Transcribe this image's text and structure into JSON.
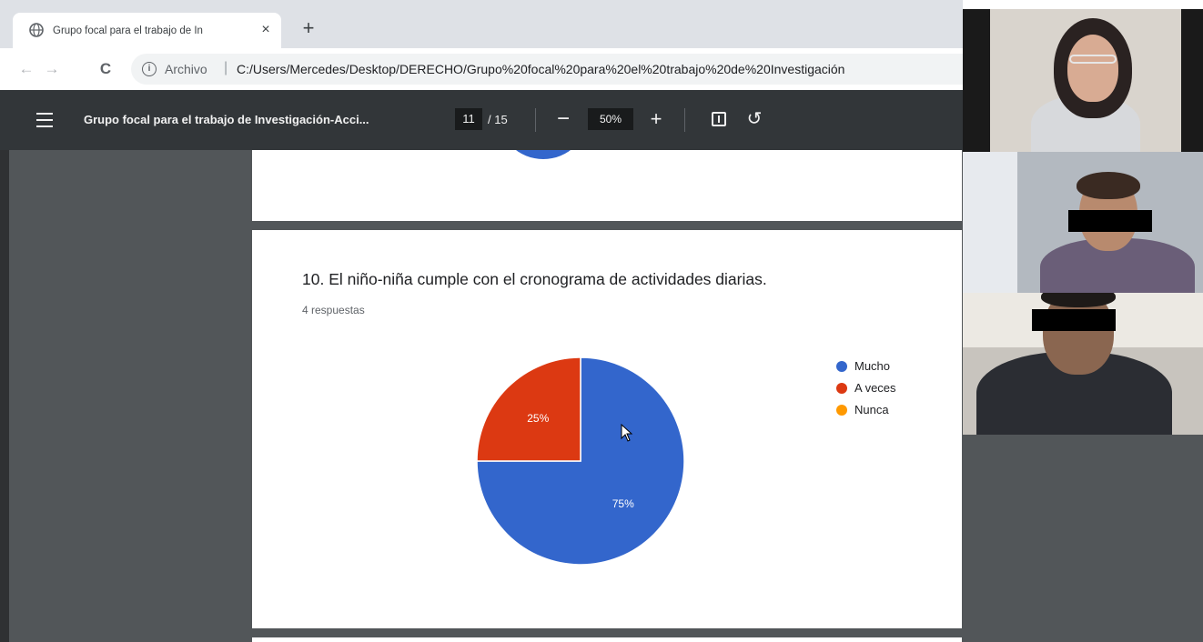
{
  "browser": {
    "tab": {
      "title": "Grupo focal para el trabajo de In",
      "close_label": "×"
    },
    "new_tab_label": "+",
    "address": {
      "security_label": "Archivo",
      "separator": "|",
      "url": "C:/Users/Mercedes/Desktop/DERECHO/Grupo%20focal%20para%20el%20trabajo%20de%20Investigación"
    },
    "nav": {
      "back": "←",
      "forward": "→",
      "reload": "C"
    }
  },
  "pdf_toolbar": {
    "title": "Grupo focal para el trabajo de Investigación-Acci...",
    "page_current": "11",
    "page_total": "/ 15",
    "zoom_out": "−",
    "zoom": "50%",
    "zoom_in": "+",
    "rotate": "↺"
  },
  "question": {
    "title": "10. El niño-niña cumple con el cronograma de actividades diarias.",
    "responses": "4 respuestas"
  },
  "chart_data": {
    "type": "pie",
    "title": "",
    "labels": [
      "Mucho",
      "A veces",
      "Nunca"
    ],
    "values": [
      75,
      25,
      0
    ],
    "slice_labels": [
      "75%",
      "25%",
      ""
    ],
    "colors": [
      "#3366cc",
      "#dc3912",
      "#ff9900"
    ],
    "legend_position": "right"
  },
  "video_call": {
    "tile_colors": {
      "tile1_bg": "#d9d4cd",
      "tile2_bg": "#b3b9c0",
      "tile3_bg": "#c8c4be"
    }
  },
  "icons": {
    "tab": "globe-icon",
    "address": "info-icon",
    "toolbar": [
      "menu-icon",
      "fit-page-icon",
      "rotate-icon"
    ],
    "pointer": "cursor-icon"
  }
}
